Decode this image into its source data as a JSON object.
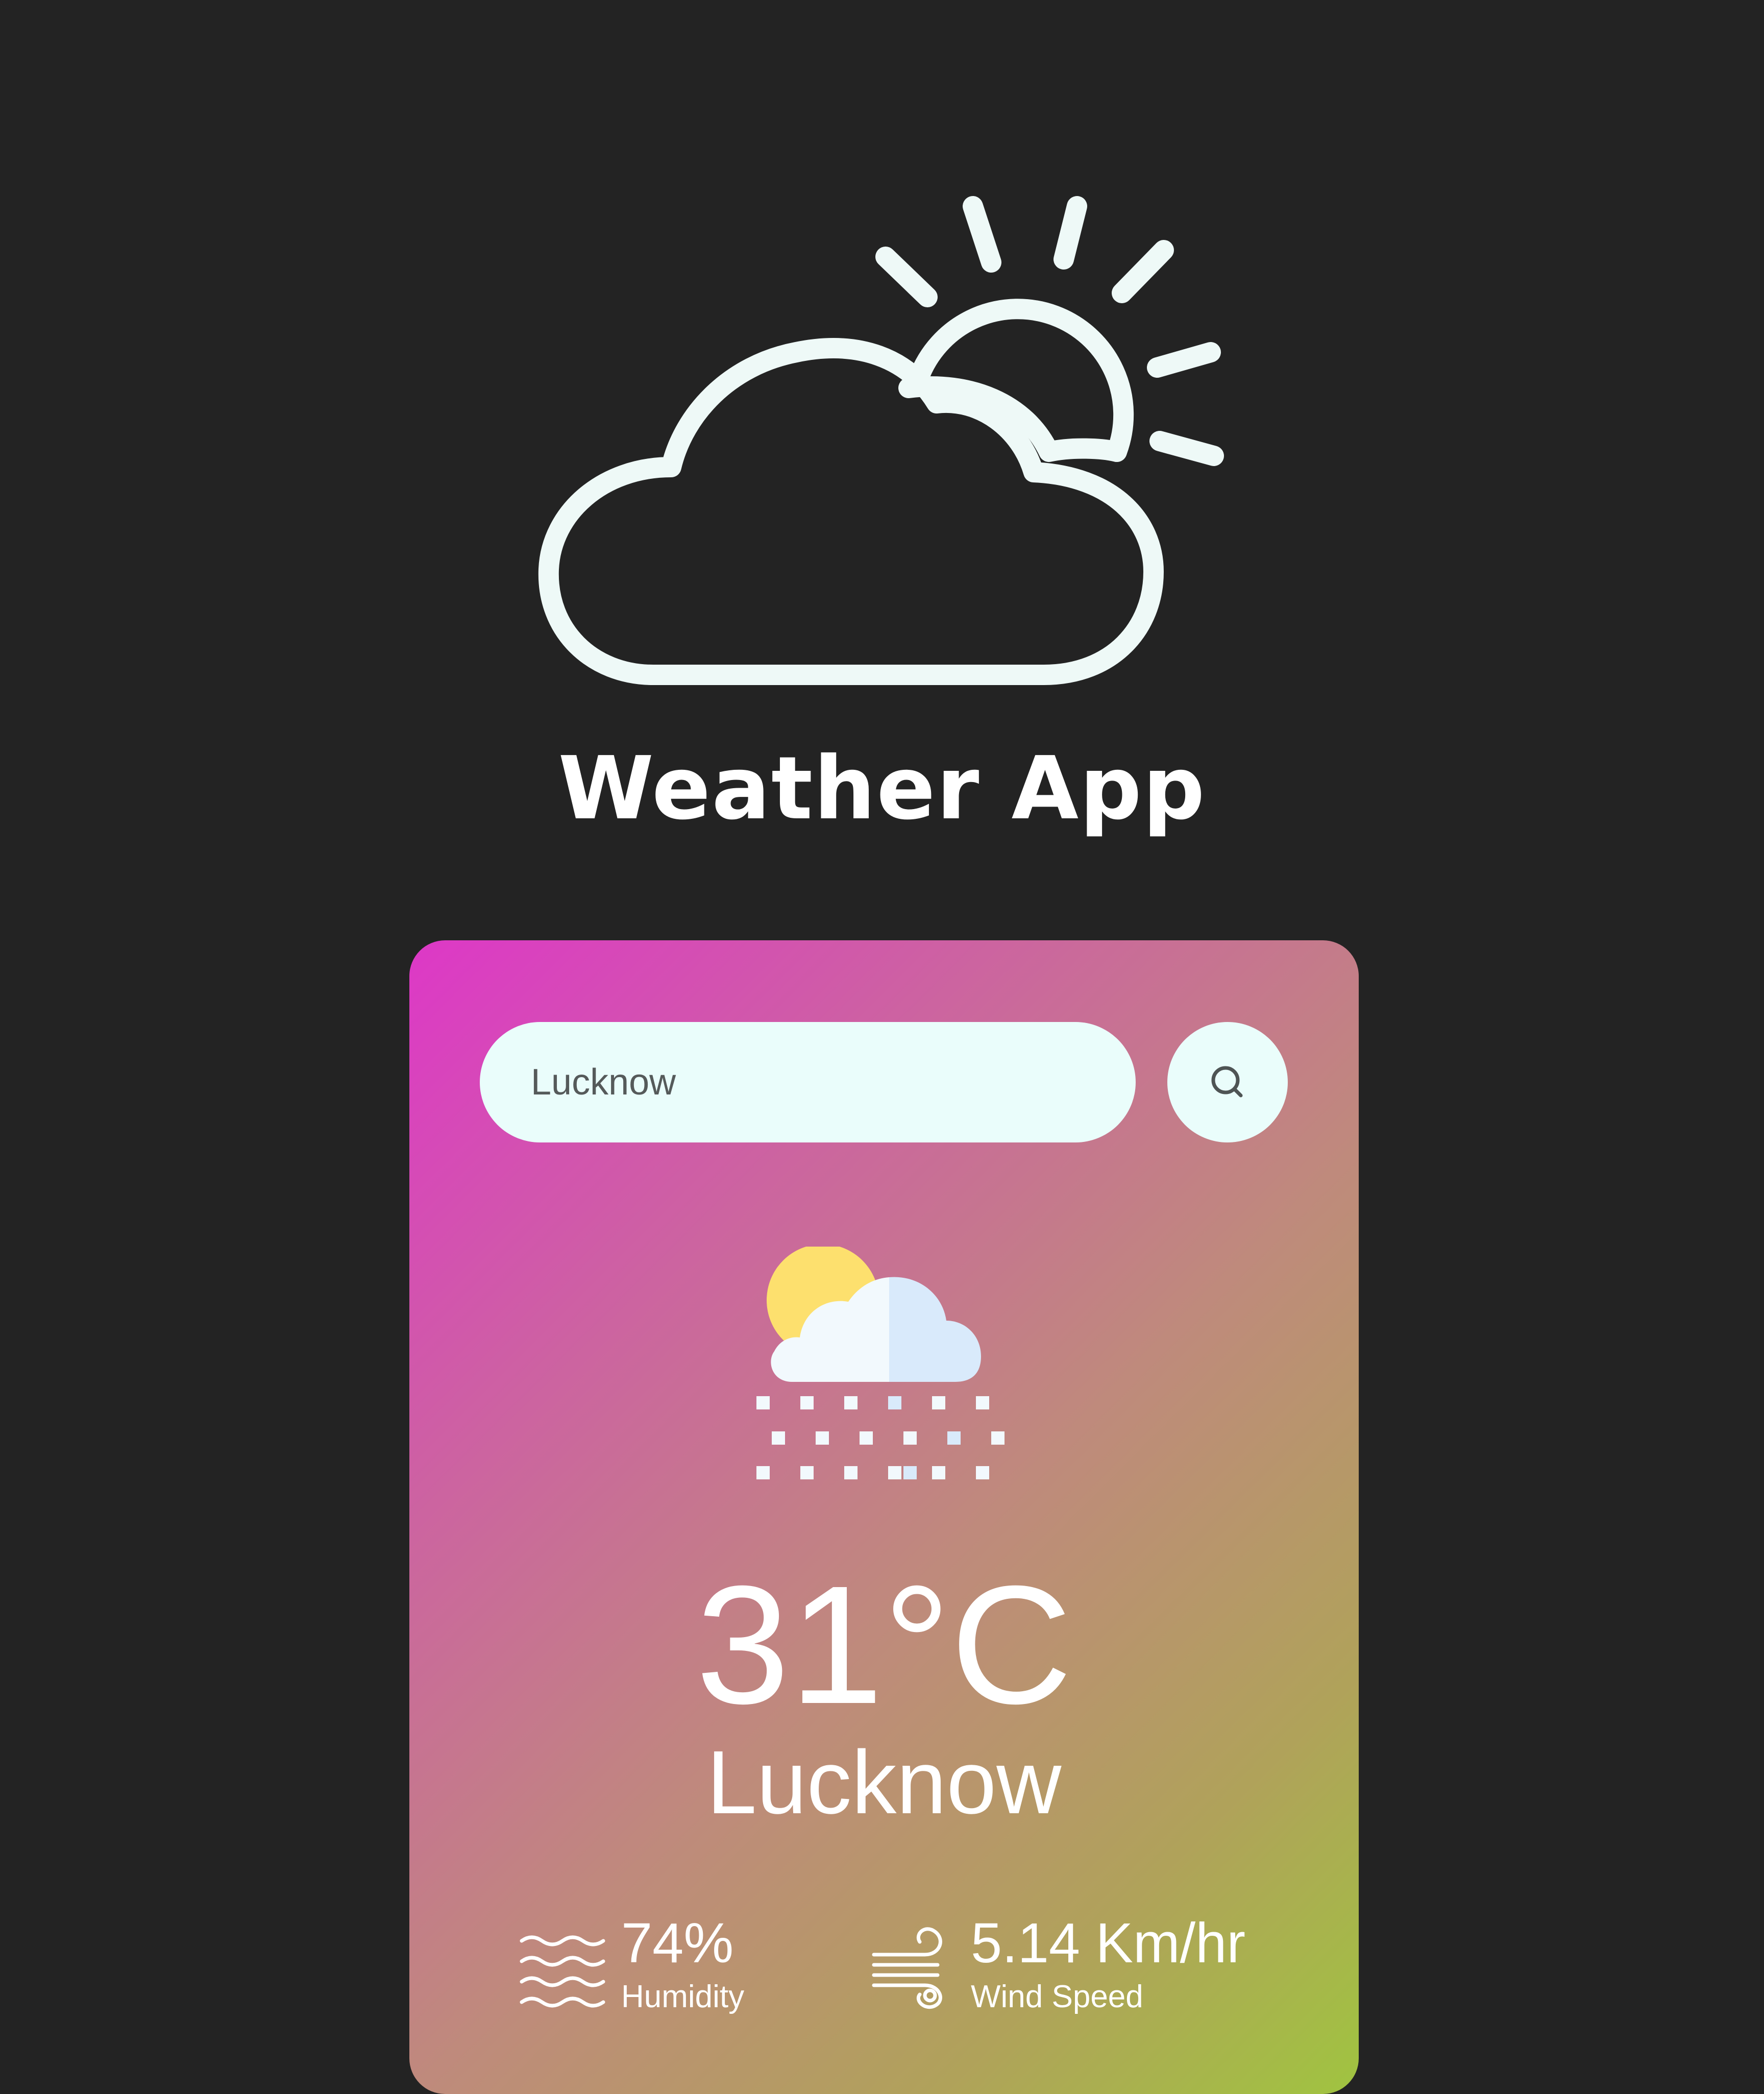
{
  "app": {
    "title": "Weather App",
    "logo_icon": "cloud-sun-outline-icon"
  },
  "search": {
    "value": "Lucknow",
    "button_icon": "search-icon"
  },
  "weather": {
    "icon": "partly-cloudy-snow-icon",
    "temperature": "31°C",
    "city": "Lucknow"
  },
  "details": {
    "humidity": {
      "icon": "humidity-waves-icon",
      "value": "74%",
      "label": "Humidity"
    },
    "wind": {
      "icon": "wind-icon",
      "value": "5.14 Km/hr",
      "label": "Wind Speed"
    }
  },
  "colors": {
    "background": "#232323",
    "card_gradient_start": "#dd38c7",
    "card_gradient_end": "#a0c440",
    "input_bg": "#eafdfb",
    "logo_stroke": "#eef9f7"
  }
}
